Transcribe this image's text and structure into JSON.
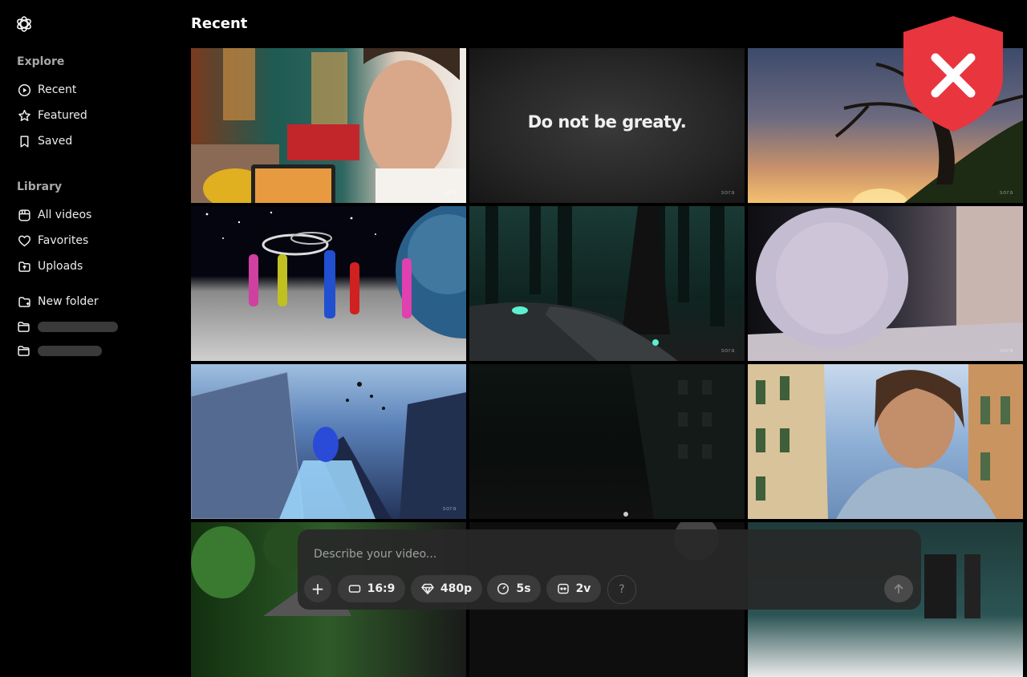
{
  "sidebar": {
    "explore_title": "Explore",
    "explore_items": [
      {
        "label": "Recent",
        "icon": "play-circle-icon"
      },
      {
        "label": "Featured",
        "icon": "star-icon"
      },
      {
        "label": "Saved",
        "icon": "bookmark-icon"
      }
    ],
    "library_title": "Library",
    "library_items": [
      {
        "label": "All videos",
        "icon": "gallery-icon"
      },
      {
        "label": "Favorites",
        "icon": "heart-icon"
      },
      {
        "label": "Uploads",
        "icon": "upload-icon"
      }
    ],
    "new_folder_label": "New folder"
  },
  "main": {
    "title": "Recent",
    "tiles": [
      {
        "caption": "",
        "watermark": "sora"
      },
      {
        "caption": "Do not be greaty.",
        "watermark": "sora"
      },
      {
        "caption": "",
        "watermark": "sora"
      },
      {
        "caption": "",
        "watermark": ""
      },
      {
        "caption": "",
        "watermark": "sora"
      },
      {
        "caption": "",
        "watermark": "sora"
      },
      {
        "caption": "",
        "watermark": "sora"
      },
      {
        "caption": "",
        "watermark": ""
      },
      {
        "caption": "",
        "watermark": ""
      }
    ]
  },
  "composer": {
    "placeholder": "Describe your video...",
    "add_label": "+",
    "aspect_label": "16:9",
    "resolution_label": "480p",
    "duration_label": "5s",
    "variations_label": "2v",
    "help_label": "?"
  },
  "overlay": {
    "icon": "blocked-shield-icon",
    "color": "#e8353e"
  }
}
